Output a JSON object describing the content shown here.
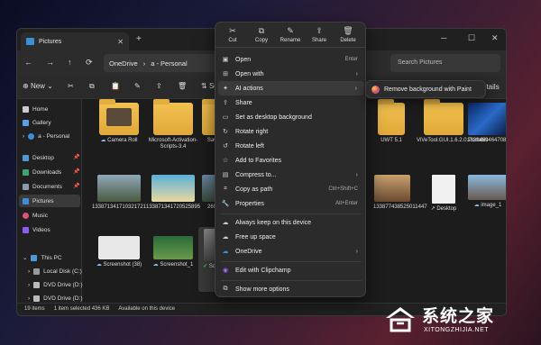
{
  "window": {
    "tab_title": "Pictures",
    "address": {
      "part1": "OneDrive",
      "part2": "a - Personal"
    },
    "search_placeholder": "Search Pictures",
    "toolbar": {
      "new_label": "New",
      "sort_label": "So",
      "details_label": "Details"
    }
  },
  "sidebar": {
    "items": [
      {
        "label": "Home"
      },
      {
        "label": "Gallery"
      },
      {
        "label": "a - Personal"
      },
      {
        "label": "Desktop"
      },
      {
        "label": "Downloads"
      },
      {
        "label": "Documents"
      },
      {
        "label": "Pictures"
      },
      {
        "label": "Music"
      },
      {
        "label": "Videos"
      },
      {
        "label": "This PC"
      },
      {
        "label": "Local Disk (C:)"
      },
      {
        "label": "DVD Drive (D:)"
      },
      {
        "label": "DVD Drive (D:)"
      }
    ]
  },
  "files": {
    "row1": [
      {
        "name": "Camera Roll"
      },
      {
        "name": "Microsoft-Activation-Scripts-3.4"
      },
      {
        "name": "Sav"
      },
      {
        "name": "UWT 5.1"
      },
      {
        "name": "ViVeTool.GUI.1.6.2.0.Portable"
      },
      {
        "name": "133846946470884516"
      }
    ],
    "row2": [
      {
        "name": "133871341710321721"
      },
      {
        "name": "133871341720525895"
      },
      {
        "name": "269"
      },
      {
        "name": "133877438525011447"
      },
      {
        "name": "Desktop"
      },
      {
        "name": "image_1"
      }
    ],
    "row3": [
      {
        "name": "Screenshot (38)"
      },
      {
        "name": "Screenshot_1"
      },
      {
        "name": "Sc 1 2"
      }
    ]
  },
  "status": {
    "count": "19 items",
    "selected": "1 item selected 436 KB",
    "availability": "Available on this device"
  },
  "context_menu": {
    "top": [
      {
        "label": "Cut"
      },
      {
        "label": "Copy"
      },
      {
        "label": "Rename"
      },
      {
        "label": "Share"
      },
      {
        "label": "Delete"
      }
    ],
    "items": [
      {
        "label": "Open",
        "shortcut": "Enter"
      },
      {
        "label": "Open with"
      },
      {
        "label": "AI actions"
      },
      {
        "label": "Share"
      },
      {
        "label": "Set as desktop background"
      },
      {
        "label": "Rotate right"
      },
      {
        "label": "Rotate left"
      },
      {
        "label": "Add to Favorites"
      },
      {
        "label": "Compress to..."
      },
      {
        "label": "Copy as path",
        "shortcut": "Ctrl+Shift+C"
      },
      {
        "label": "Properties",
        "shortcut": "Alt+Enter"
      },
      {
        "label": "Always keep on this device"
      },
      {
        "label": "Free up space"
      },
      {
        "label": "OneDrive"
      },
      {
        "label": "Edit with Clipchamp"
      },
      {
        "label": "Show more options"
      }
    ],
    "submenu": {
      "label": "Remove background with Paint"
    }
  },
  "watermark": {
    "title": "系统之家",
    "url": "XITONGZHIJIA.NET"
  },
  "colors": {
    "folder": "#f2c14e",
    "accent": "#3b8edb",
    "menu_bg": "#2b2b2b"
  }
}
